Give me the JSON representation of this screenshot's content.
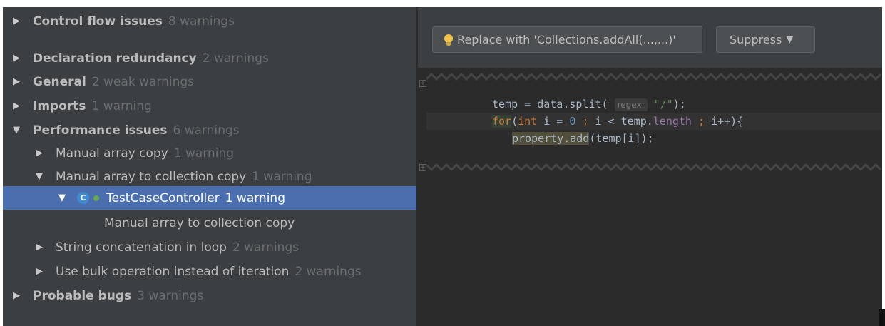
{
  "tree": {
    "items": [
      {
        "arrow": "▶",
        "label": "Control flow issues",
        "count": "8 warnings"
      },
      {
        "arrow": "▶",
        "label": "Declaration redundancy",
        "count": "2 warnings"
      },
      {
        "arrow": "▶",
        "label": "General",
        "count": "2 weak warnings"
      },
      {
        "arrow": "▶",
        "label": "Imports",
        "count": "1 warning"
      },
      {
        "arrow": "▼",
        "label": "Performance issues",
        "count": "6 warnings"
      },
      {
        "arrow": "▶",
        "label": "Manual array copy",
        "count": "1 warning"
      },
      {
        "arrow": "▼",
        "label": "Manual array to collection copy",
        "count": "1 warning"
      },
      {
        "arrow": "▼",
        "icon": "C",
        "label": "TestCaseController",
        "count": "1 warning"
      },
      {
        "label": "Manual array to collection copy"
      },
      {
        "arrow": "▶",
        "label": "String concatenation in loop",
        "count": "2 warnings"
      },
      {
        "arrow": "▶",
        "label": "Use bulk operation instead of iteration",
        "count": "2 warnings"
      },
      {
        "arrow": "▶",
        "label": "Probable bugs",
        "count": "3 warnings"
      }
    ]
  },
  "toolbar": {
    "fix_label": "Replace with 'Collections.addAll(...,...)'",
    "suppress_label": "Suppress",
    "suppress_caret": "▼"
  },
  "editor": {
    "line1": {
      "pre": "temp = data.split( ",
      "hint": "regex:",
      "str": "\"/\"",
      "post": ");"
    },
    "line2": {
      "kw_for": "for",
      "paren": "(",
      "kw_int": "int",
      "mid1": " i = ",
      "zero": "0",
      "semi1": " ; ",
      "mid2": "i < temp.",
      "field": "length",
      "semi2": " ; ",
      "end": "i++){"
    },
    "line3": {
      "call": "property.add",
      "args": "(temp[i]);"
    },
    "fold_symbol": "+"
  },
  "colors": {
    "panel_bg": "#3c3f41",
    "editor_bg": "#2b2b2b",
    "selection": "#4b6eaf",
    "keyword": "#cc7832",
    "number": "#6897bb",
    "string": "#6a8759"
  },
  "icons": {
    "tree_arrow_collapsed": "triangle-right-icon",
    "tree_arrow_expanded": "triangle-down-icon",
    "class_icon": "class-icon",
    "quickfix_icon": "lightbulb-icon"
  }
}
